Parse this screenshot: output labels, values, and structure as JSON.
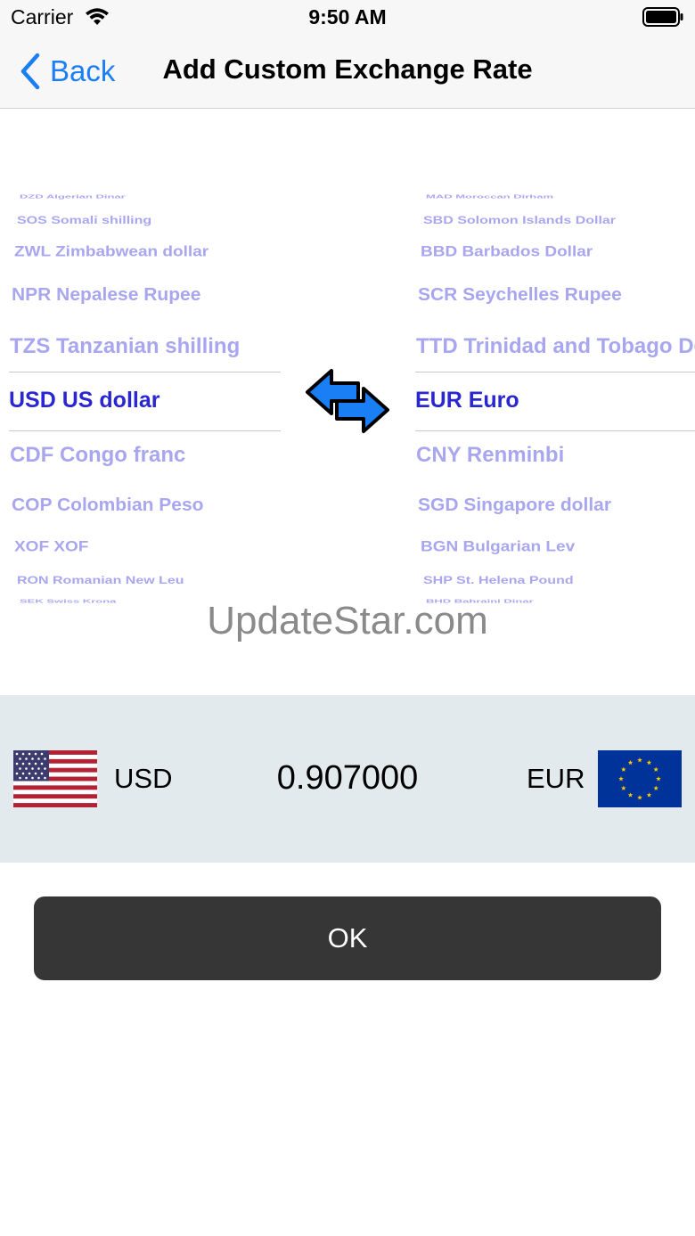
{
  "status_bar": {
    "carrier": "Carrier",
    "time": "9:50 AM"
  },
  "nav": {
    "back_label": "Back",
    "title": "Add Custom Exchange Rate"
  },
  "left_picker": {
    "items": [
      "DZD Algerian Dinar",
      "SOS Somali shilling",
      "ZWL Zimbabwean dollar",
      "NPR Nepalese Rupee",
      "TZS Tanzanian shilling",
      "USD US dollar",
      "CDF Congo franc",
      "COP Colombian Peso",
      "XOF XOF",
      "RON Romanian New Leu",
      "SEK Swiss Krona"
    ],
    "selected": "USD US dollar"
  },
  "right_picker": {
    "items": [
      "MAD Moroccan Dirham",
      "SBD Solomon Islands Dollar",
      "BBD Barbados Dollar",
      "SCR Seychelles Rupee",
      "TTD Trinidad and Tobago Dollar",
      "EUR Euro",
      "CNY Renminbi",
      "SGD Singapore dollar",
      "BGN Bulgarian Lev",
      "SHP St. Helena Pound",
      "BHD Bahraini Dinar"
    ],
    "selected": "EUR Euro"
  },
  "watermark": "UpdateStar.com",
  "rate": {
    "from_code": "USD",
    "to_code": "EUR",
    "value": "0.907000"
  },
  "ok_label": "OK",
  "colors": {
    "accent": "#1a7ef5",
    "picker_selected": "#2a27d0",
    "picker_faded": "#a9a6f0",
    "panel_bg": "#e3eaed",
    "ok_bg": "#363636",
    "swap_arrow": "#1a7ef5"
  },
  "icons": [
    "wifi-icon",
    "battery-icon",
    "back-chevron-icon",
    "swap-arrows-icon",
    "us-flag-icon",
    "eu-flag-icon"
  ]
}
